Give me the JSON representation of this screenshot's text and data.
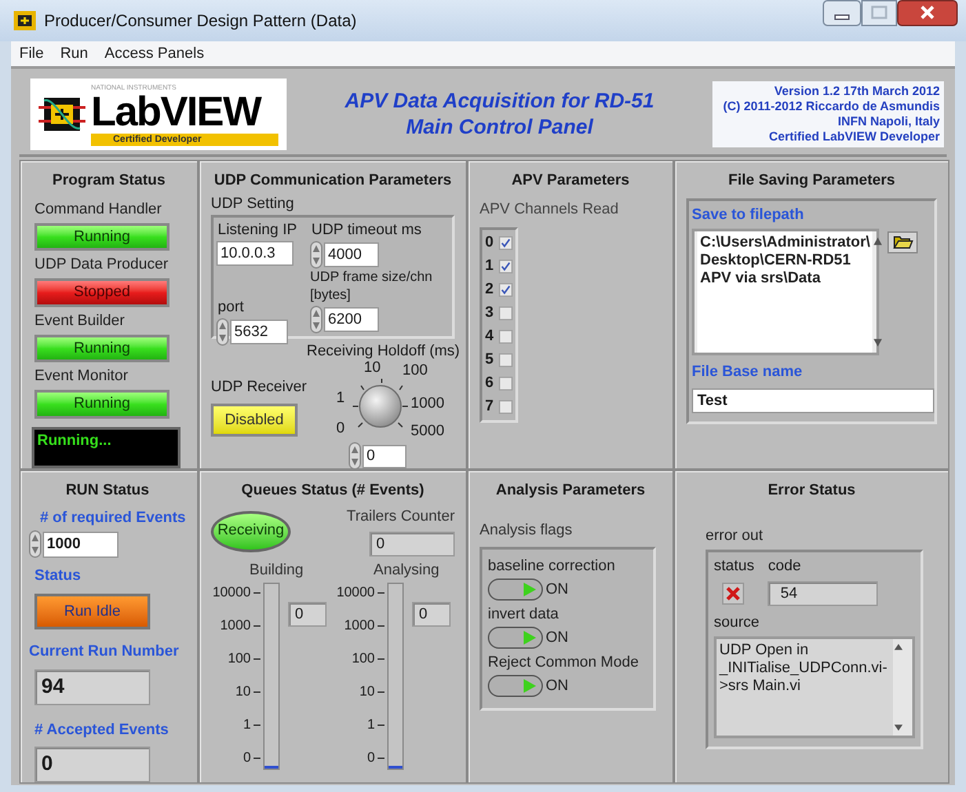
{
  "window": {
    "title": "Producer/Consumer Design Pattern (Data)"
  },
  "menu": [
    "File",
    "Run",
    "Access Panels"
  ],
  "header": {
    "logo": {
      "maker": "NATIONAL INSTRUMENTS",
      "wordmark": "LabVIEW",
      "badge": "Certified Developer"
    },
    "title_lines": [
      "APV Data Acquisition for RD-51",
      "Main Control Panel"
    ],
    "credits": [
      "Version 1.2 17th March 2012",
      "(C) 2011-2012 Riccardo de Asmundis",
      "INFN Napoli, Italy",
      "Certified LabVIEW Developer"
    ]
  },
  "program_status": {
    "title": "Program Status",
    "indicators": [
      {
        "label": "Command Handler",
        "text": "Running",
        "on": true
      },
      {
        "label": "UDP Data Producer",
        "text": "Stopped",
        "on": false
      },
      {
        "label": "Event Builder",
        "text": "Running",
        "on": true
      },
      {
        "label": "Event Monitor",
        "text": "Running",
        "on": true
      }
    ],
    "message": "Running..."
  },
  "udp": {
    "title": "UDP Communication Parameters",
    "setting_label": "UDP Setting",
    "listening_ip": {
      "label": "Listening IP",
      "value": "10.0.0.3"
    },
    "timeout": {
      "label": "UDP timeout ms",
      "value": "4000"
    },
    "port": {
      "label": "port",
      "value": "5632"
    },
    "frame_size": {
      "label_lines": [
        "UDP frame size/chn",
        "[bytes]"
      ],
      "value": "6200"
    },
    "receiver": {
      "label": "UDP Receiver",
      "text": "Disabled",
      "enabled": false
    },
    "holdoff": {
      "label": "Receiving Holdoff (ms)",
      "scale": [
        "0",
        "1",
        "10",
        "100",
        "1000",
        "5000"
      ],
      "value": "0"
    }
  },
  "apv": {
    "title": "APV Parameters",
    "group_label": "APV Channels Read",
    "channels": [
      {
        "label": "0",
        "checked": true
      },
      {
        "label": "1",
        "checked": true
      },
      {
        "label": "2",
        "checked": true
      },
      {
        "label": "3",
        "checked": false
      },
      {
        "label": "4",
        "checked": false
      },
      {
        "label": "5",
        "checked": false
      },
      {
        "label": "6",
        "checked": false
      },
      {
        "label": "7",
        "checked": false
      }
    ]
  },
  "file_saving": {
    "title": "File Saving Parameters",
    "path": {
      "label": "Save to filepath",
      "lines": [
        "C:\\Users\\Administrator\\",
        "Desktop\\CERN-RD51",
        "APV via srs\\Data"
      ]
    },
    "base_name": {
      "label": "File Base name",
      "value": "Test"
    }
  },
  "run_status": {
    "title": "RUN Status",
    "required": {
      "label": "# of required Events",
      "value": "1000"
    },
    "status": {
      "label": "Status",
      "text": "Run Idle"
    },
    "run_number": {
      "label": "Current Run Number",
      "value": "94"
    },
    "accepted": {
      "label": "# Accepted Events",
      "value": "0"
    }
  },
  "queues": {
    "title": "Queues Status (# Events)",
    "receiving": {
      "text": "Receiving",
      "on": true
    },
    "trailers": {
      "label": "Trailers Counter",
      "value": "0"
    },
    "meters": [
      {
        "label": "Building",
        "ticks": [
          "10000",
          "1000",
          "100",
          "10",
          "1",
          "0"
        ],
        "value": "0",
        "level": 0
      },
      {
        "label": "Analysing",
        "ticks": [
          "10000",
          "1000",
          "100",
          "10",
          "1",
          "0"
        ],
        "value": "0",
        "level": 0
      }
    ]
  },
  "analysis": {
    "title": "Analysis Parameters",
    "group_label": "Analysis flags",
    "flags": [
      {
        "label": "baseline correction",
        "on": true,
        "text": "ON"
      },
      {
        "label": "invert data",
        "on": true,
        "text": "ON"
      },
      {
        "label": "Reject Common Mode",
        "on": true,
        "text": "ON"
      }
    ]
  },
  "error": {
    "title": "Error Status",
    "cluster_label": "error out",
    "status": {
      "label": "status",
      "error": true
    },
    "code": {
      "label": "code",
      "value": "54"
    },
    "source": {
      "label": "source",
      "lines": [
        "UDP Open in",
        "_INITialise_UDPConn.vi-",
        ">srs Main.vi"
      ]
    }
  }
}
